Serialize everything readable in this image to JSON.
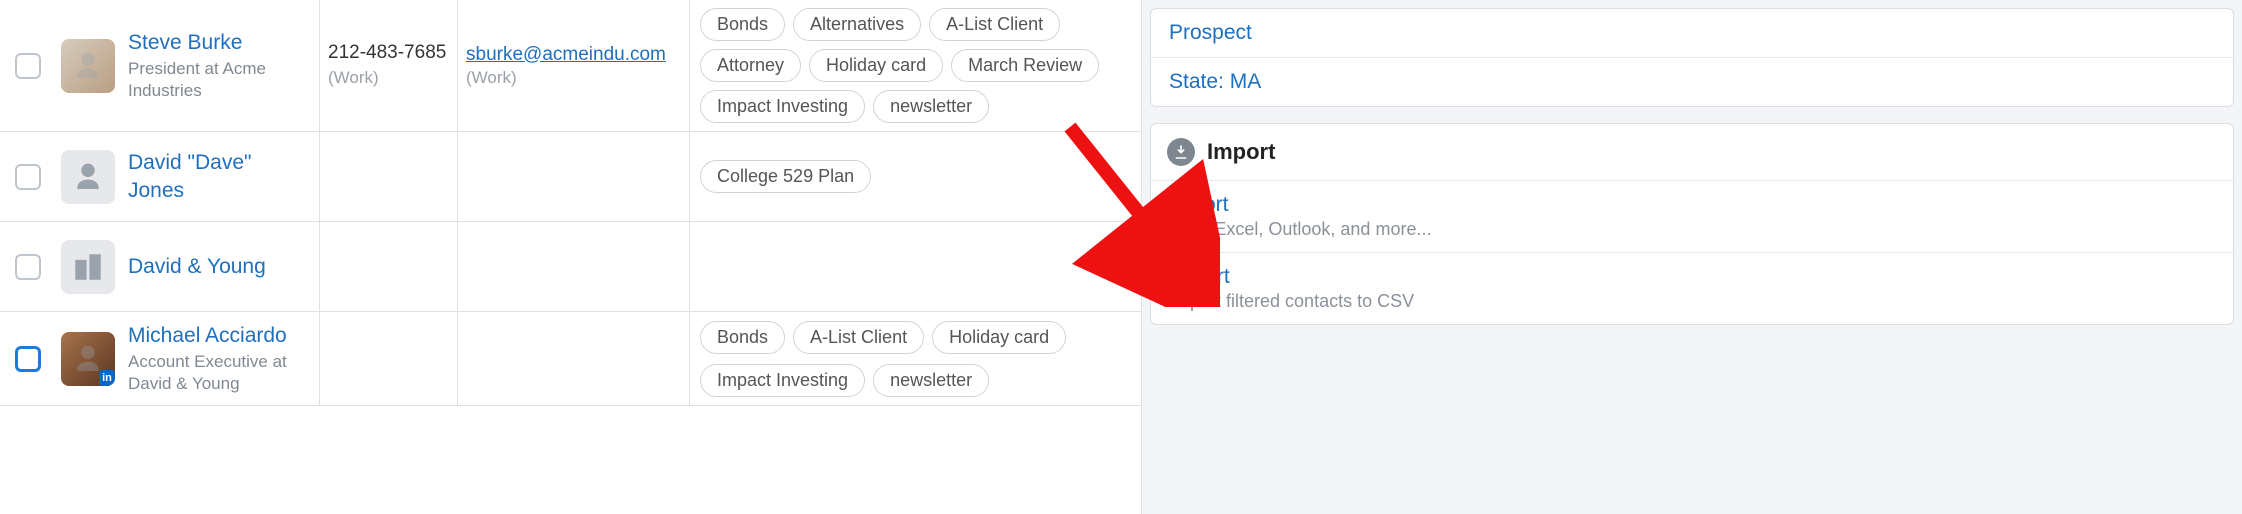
{
  "contacts": [
    {
      "name": "Steve Burke",
      "subtitle": "President at Acme Industries",
      "phone": "212-483-7685",
      "phone_label": "(Work)",
      "email": "sburke@acmeindu.com",
      "email_label": "(Work)",
      "tags": [
        "Bonds",
        "Alternatives",
        "A-List Client",
        "Attorney",
        "Holiday card",
        "March Review",
        "Impact Investing",
        "newsletter"
      ],
      "avatar_kind": "photo1",
      "has_linkedin": false,
      "checkbox_focused": false
    },
    {
      "name": "David \"Dave\" Jones",
      "subtitle": "",
      "phone": "",
      "phone_label": "",
      "email": "",
      "email_label": "",
      "tags": [
        "College 529 Plan"
      ],
      "avatar_kind": "person",
      "has_linkedin": false,
      "checkbox_focused": false
    },
    {
      "name": "David & Young",
      "subtitle": "",
      "phone": "",
      "phone_label": "",
      "email": "",
      "email_label": "",
      "tags": [],
      "avatar_kind": "company",
      "has_linkedin": false,
      "checkbox_focused": false
    },
    {
      "name": "Michael Acciardo",
      "subtitle": "Account Executive at David & Young",
      "phone": "",
      "phone_label": "",
      "email": "",
      "email_label": "",
      "tags": [
        "Bonds",
        "A-List Client",
        "Holiday card",
        "Impact Investing",
        "newsletter"
      ],
      "avatar_kind": "photo4",
      "has_linkedin": true,
      "checkbox_focused": true
    }
  ],
  "sidebar": {
    "filters": {
      "prospect": "Prospect",
      "state": "State: MA"
    },
    "import_section": {
      "header": "Import",
      "import_link": "Import",
      "import_sub": "CSV, Excel, Outlook, and more...",
      "export_link": "Export",
      "export_sub": "Export filtered contacts to CSV"
    }
  }
}
